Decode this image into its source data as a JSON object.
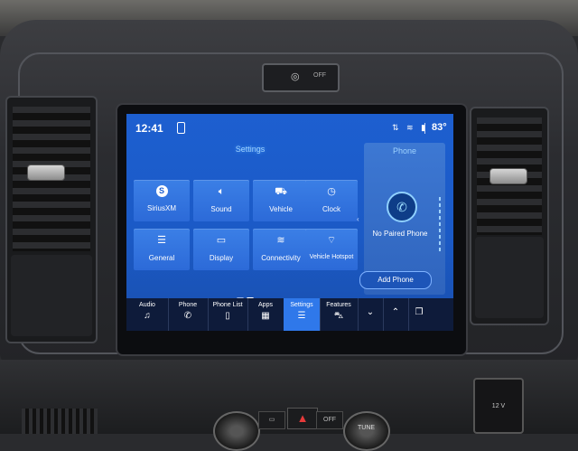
{
  "status": {
    "time": "12:41",
    "temperature": "83°",
    "icons": [
      "phone-status-icon",
      "location-icon",
      "wifi-icon",
      "signal-icon"
    ]
  },
  "settings": {
    "title": "Settings",
    "tiles": [
      {
        "label": "SiriusXM",
        "icon": "siriusxm-icon",
        "glyph": "S"
      },
      {
        "label": "Sound",
        "icon": "speaker-icon",
        "glyph": "🔈︎"
      },
      {
        "label": "Vehicle",
        "icon": "vehicle-icon",
        "glyph": "⛟︎"
      },
      {
        "label": "Clock",
        "icon": "clock-icon",
        "glyph": "◷"
      },
      {
        "label": "General",
        "icon": "sliders-icon",
        "glyph": "☰"
      },
      {
        "label": "Display",
        "icon": "display-icon",
        "glyph": "▭"
      },
      {
        "label": "Connectivity",
        "icon": "wifi-icon",
        "glyph": "≋"
      },
      {
        "label": "Vehicle Hotspot",
        "icon": "hotspot-icon",
        "glyph": "⌔"
      }
    ]
  },
  "phone_panel": {
    "title": "Phone",
    "status": "No Paired Phone",
    "add_button": "Add Phone"
  },
  "bottom_nav": [
    {
      "label": "Audio",
      "icon": "music-icon",
      "glyph": "♫",
      "active": false
    },
    {
      "label": "Phone",
      "icon": "phone-icon",
      "glyph": "✆",
      "active": false
    },
    {
      "label": "Phone List",
      "icon": "phone-list-icon",
      "glyph": "▯",
      "active": false
    },
    {
      "label": "Apps",
      "icon": "apps-grid-icon",
      "glyph": "▦",
      "active": false
    },
    {
      "label": "Settings",
      "icon": "settings-sliders-icon",
      "glyph": "☰",
      "active": true
    },
    {
      "label": "Features",
      "icon": "features-car-icon",
      "glyph": "⛍︎",
      "active": false
    },
    {
      "label": "",
      "icon": "chevron-down-icon",
      "glyph": "⌄",
      "active": false
    },
    {
      "label": "",
      "icon": "chevron-up-icon",
      "glyph": "⌃",
      "active": false
    },
    {
      "label": "",
      "icon": "split-screen-icon",
      "glyph": "❐",
      "active": false
    }
  ],
  "hardware": {
    "top_switch_off": "OFF",
    "hazard_off": "OFF",
    "tune_label": "TUNE",
    "outlet_label": "12 V"
  },
  "colors": {
    "screen_blue": "#1d5fd0",
    "tile_blue": "#3b7fe6",
    "active_nav": "#2f78ea",
    "nav_bar": "#0e1b3a",
    "accent_cyan": "#9fd3ff"
  }
}
